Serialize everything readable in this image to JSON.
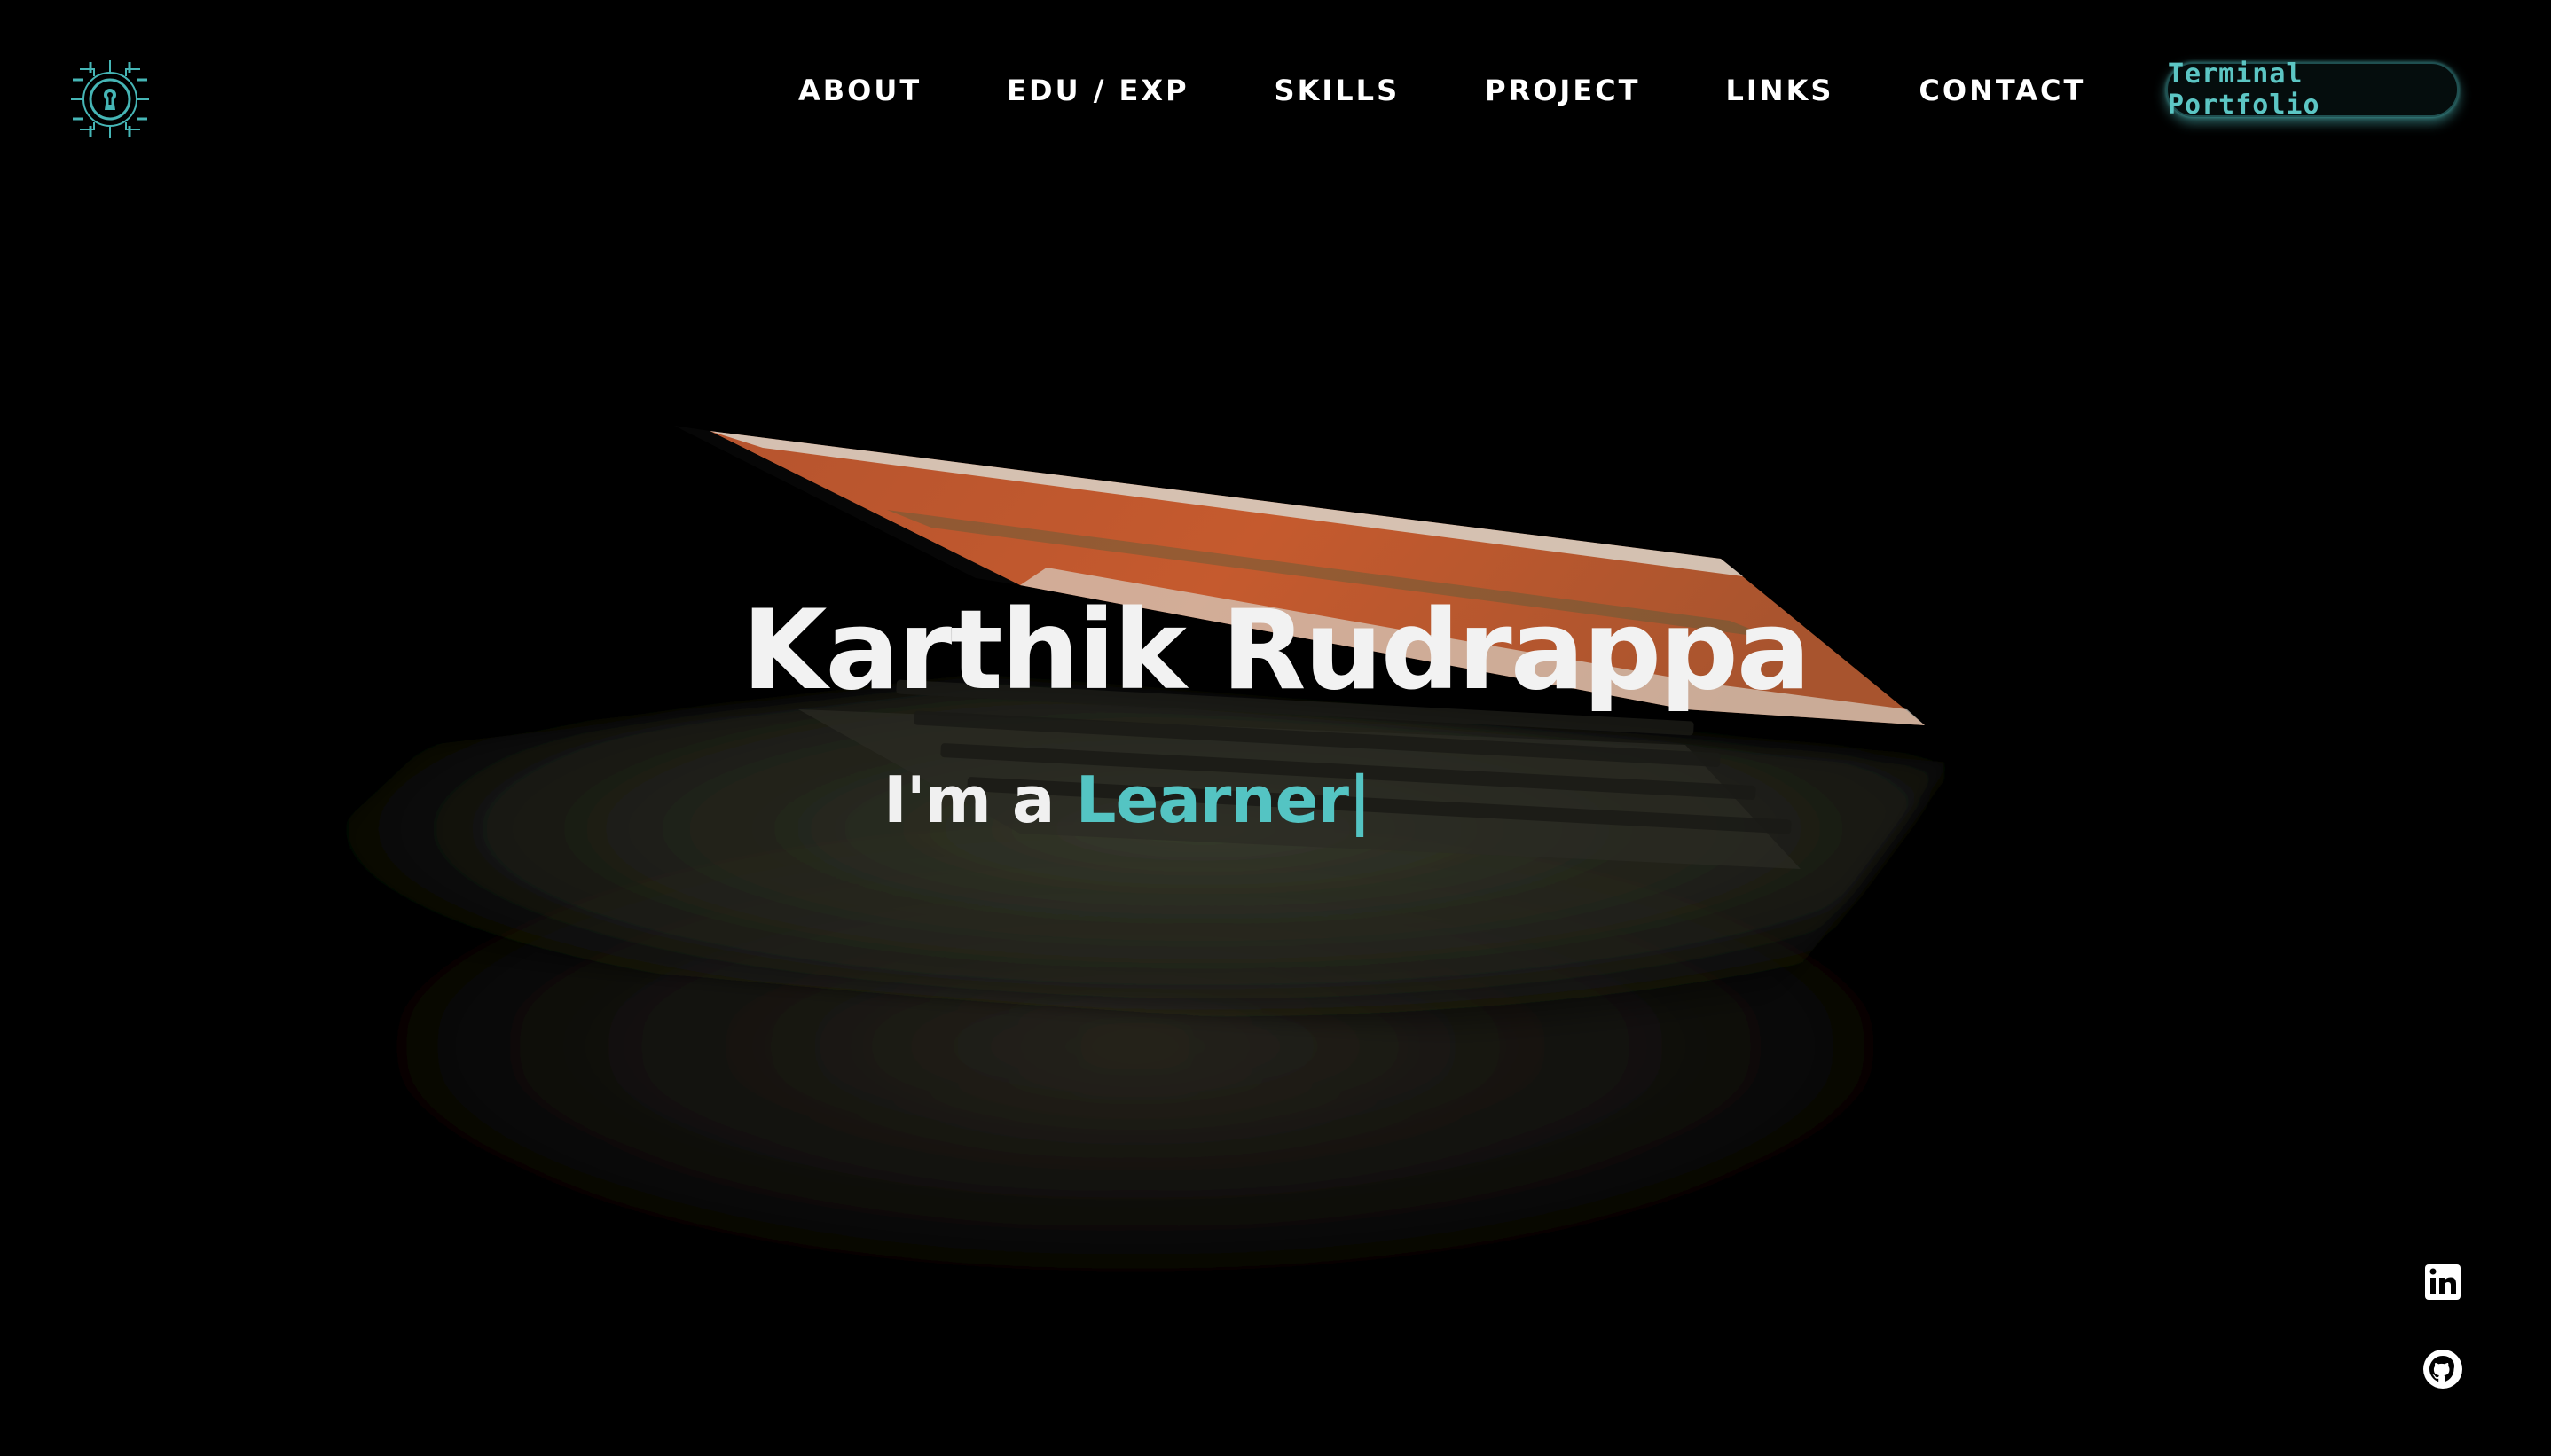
{
  "header": {
    "nav": [
      {
        "label": "ABOUT"
      },
      {
        "label": "EDU / EXP"
      },
      {
        "label": "SKILLS"
      },
      {
        "label": "PROJECT"
      },
      {
        "label": "LINKS"
      },
      {
        "label": "CONTACT"
      }
    ],
    "terminal_button": "Terminal Portfolio",
    "logo_icon": "keyhole-circuit-icon"
  },
  "hero": {
    "name": "Karthik Rudrappa",
    "role_prefix": "I'm a ",
    "role_word": "Learner",
    "cursor": "|"
  },
  "social": [
    {
      "icon": "linkedin-icon"
    },
    {
      "icon": "github-icon"
    }
  ],
  "colors": {
    "background": "#000000",
    "accent": "#54c4c3",
    "text": "#f2f2f2"
  }
}
